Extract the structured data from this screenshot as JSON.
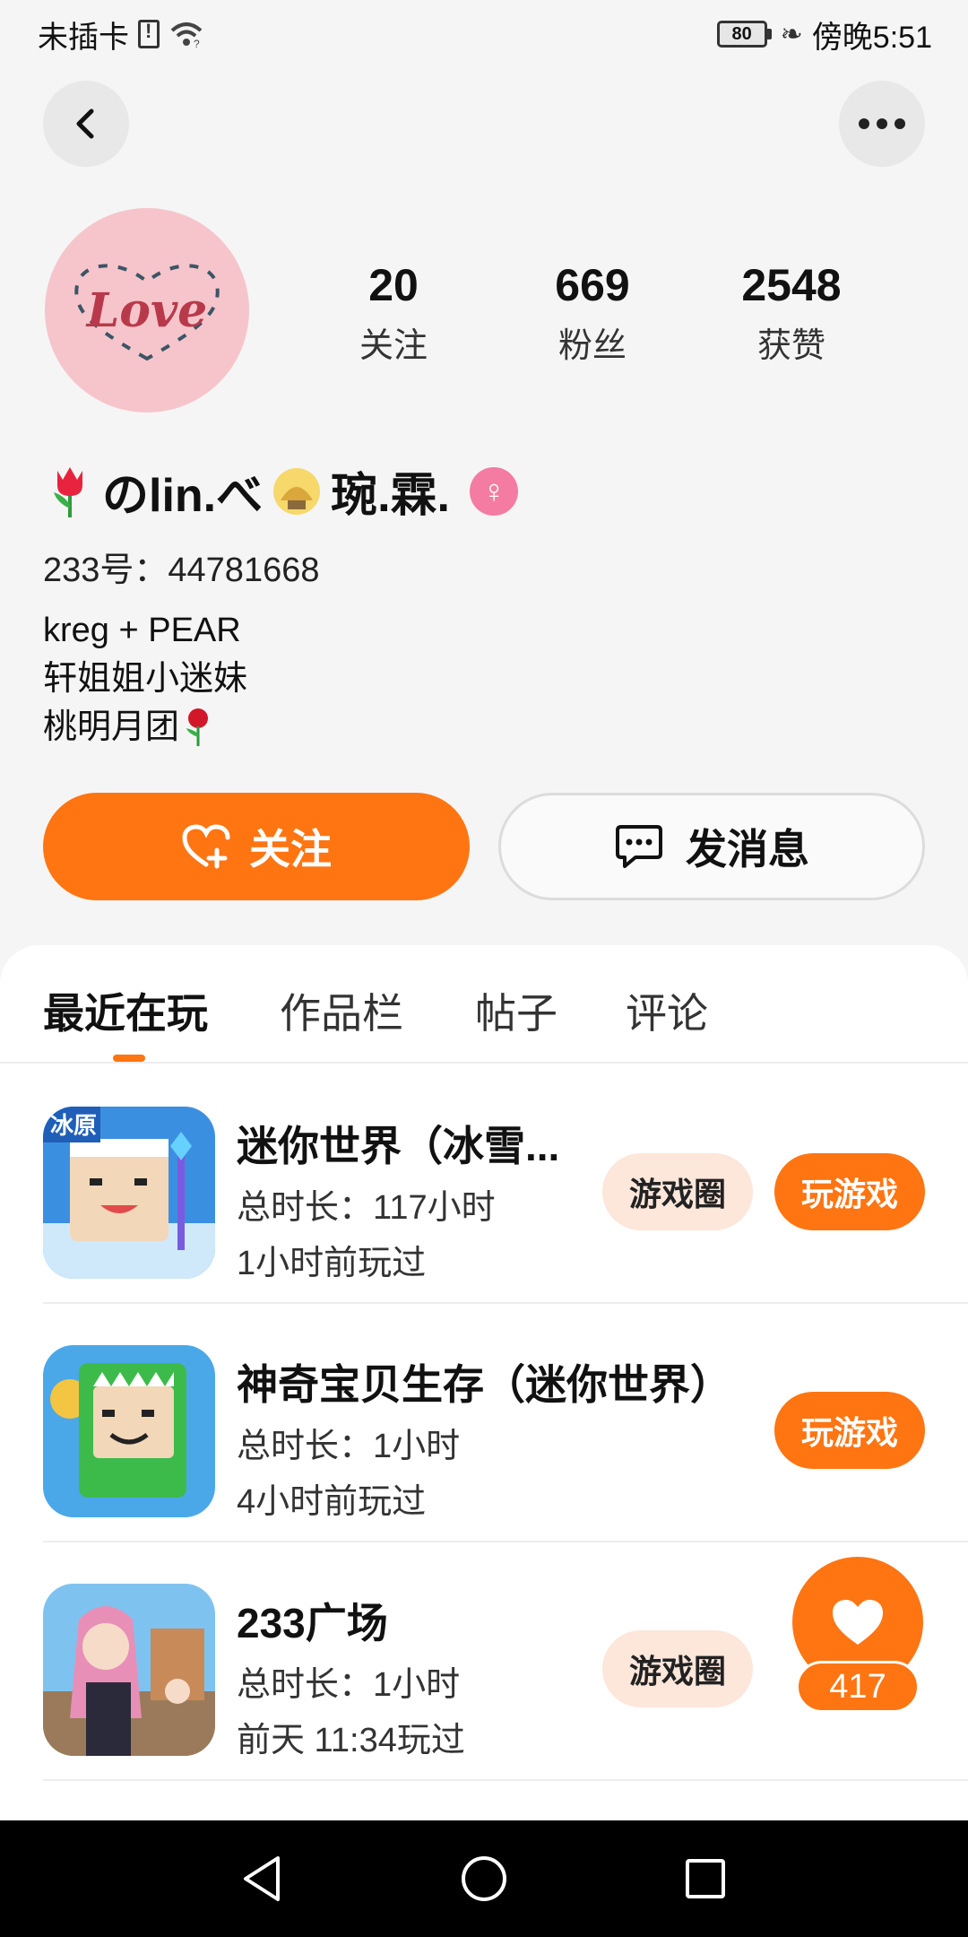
{
  "status_bar": {
    "carrier": "未插卡",
    "battery": "80",
    "time": "傍晚5:51"
  },
  "profile": {
    "nickname": "のlin.べ",
    "nickname_suffix": "琬.霖.",
    "id_label": "233号：",
    "id_value": "44781668",
    "bio_lines": [
      "kreg + PEAR",
      "轩姐姐小迷妹",
      "桃明月团"
    ],
    "avatar_text": "Love"
  },
  "stats": [
    {
      "value": "20",
      "label": "关注"
    },
    {
      "value": "669",
      "label": "粉丝"
    },
    {
      "value": "2548",
      "label": "获赞"
    }
  ],
  "actions": {
    "follow": "关注",
    "message": "发消息"
  },
  "tabs": [
    "最近在玩",
    "作品栏",
    "帖子",
    "评论"
  ],
  "games": [
    {
      "title": "迷你世界（冰雪...",
      "duration": "总时长：117小时",
      "last_played": "1小时前玩过",
      "circle_label": "游戏圈",
      "play_label": "玩游戏"
    },
    {
      "title": "神奇宝贝生存（迷你世界）",
      "duration": "总时长：1小时",
      "last_played": "4小时前玩过",
      "play_label": "玩游戏"
    },
    {
      "title": "233广场",
      "duration": "总时长：1小时",
      "last_played": "前天 11:34玩过",
      "circle_label": "游戏圈"
    }
  ],
  "like_float": {
    "count": "417"
  },
  "colors": {
    "accent": "#ff7512",
    "chip_bg": "#fde6da",
    "gender": "#f47ba2"
  }
}
